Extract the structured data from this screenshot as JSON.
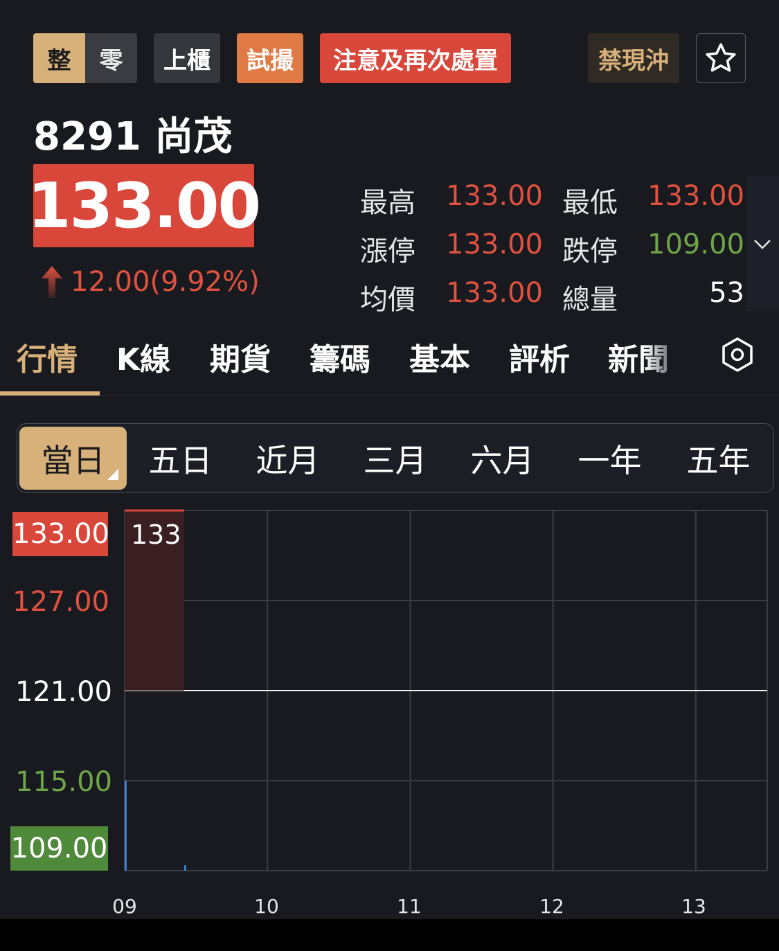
{
  "tags": {
    "board_lot": "整",
    "odd_lot": "零",
    "market": "上櫃",
    "trial": "試撮",
    "warning": "注意及再次處置",
    "day_trade": "禁現沖"
  },
  "stock": {
    "name": "8291 尚茂",
    "price": "133.00",
    "change": "12.00",
    "change_pct": "(9.92%)"
  },
  "stats": {
    "high_label": "最高",
    "high": "133.00",
    "low_label": "最低",
    "low": "133.00",
    "limit_up_label": "漲停",
    "limit_up": "133.00",
    "limit_down_label": "跌停",
    "limit_down": "109.00",
    "avg_label": "均價",
    "avg": "133.00",
    "volume_label": "總量",
    "volume": "53"
  },
  "tabs": [
    "行情",
    "K線",
    "期貨",
    "籌碼",
    "基本",
    "評析",
    "新聞"
  ],
  "range": [
    "當日",
    "五日",
    "近月",
    "三月",
    "六月",
    "一年",
    "五年"
  ],
  "colors": {
    "up": "#e0513f",
    "down": "#6fa548",
    "accent": "#d7b07a",
    "background": "#181a20"
  },
  "chart_data": {
    "type": "line",
    "x_ticks": [
      "09",
      "10",
      "11",
      "12",
      "13"
    ],
    "y_ticks": [
      "133.00",
      "127.00",
      "121.00",
      "115.00",
      "109.00"
    ],
    "ylim": [
      109,
      133
    ],
    "reference_price": 121,
    "price_label": "133",
    "series": [
      {
        "x": [
          "09:00",
          "09:25"
        ],
        "values": [
          133,
          133
        ]
      }
    ],
    "volume_series": [
      {
        "x": "09:00",
        "volume": 50
      },
      {
        "x": "09:25",
        "volume": 3
      }
    ],
    "grid": true
  }
}
